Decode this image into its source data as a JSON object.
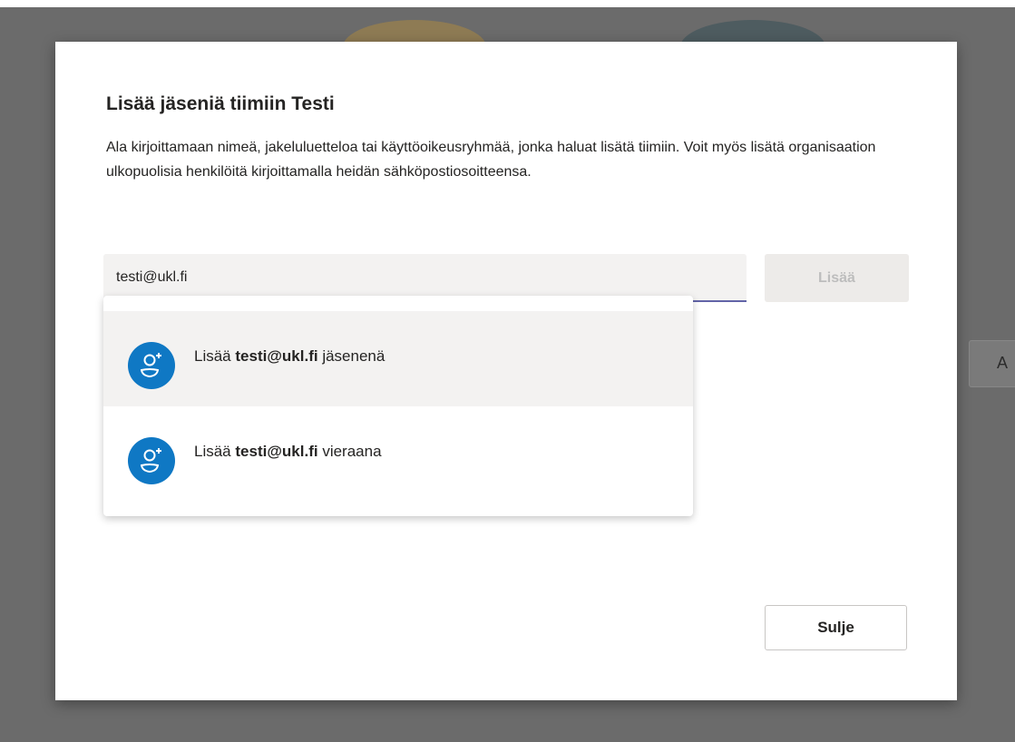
{
  "dialog": {
    "title": "Lisää jäseniä tiimiin Testi",
    "description": "Ala kirjoittamaan nimeä, jakeluluetteloa tai käyttöoikeusryhmää, jonka haluat lisätä tiimiin. Voit myös lisätä organisaation ulkopuolisia henkilöitä kirjoittamalla heidän sähköpostiosoitteensa.",
    "input_value": "testi@ukl.fi",
    "add_label": "Lisää",
    "close_label": "Sulje"
  },
  "suggestions": [
    {
      "prefix": "Lisää",
      "email": "testi@ukl.fi",
      "suffix": "jäsenenä",
      "icon": "add-person-icon"
    },
    {
      "prefix": "Lisää",
      "email": "testi@ukl.fi",
      "suffix": "vieraana",
      "icon": "add-person-icon"
    }
  ],
  "background": {
    "partial_button_label": "A"
  },
  "colors": {
    "accent": "#6264a7",
    "avatar": "#0f78c4"
  }
}
